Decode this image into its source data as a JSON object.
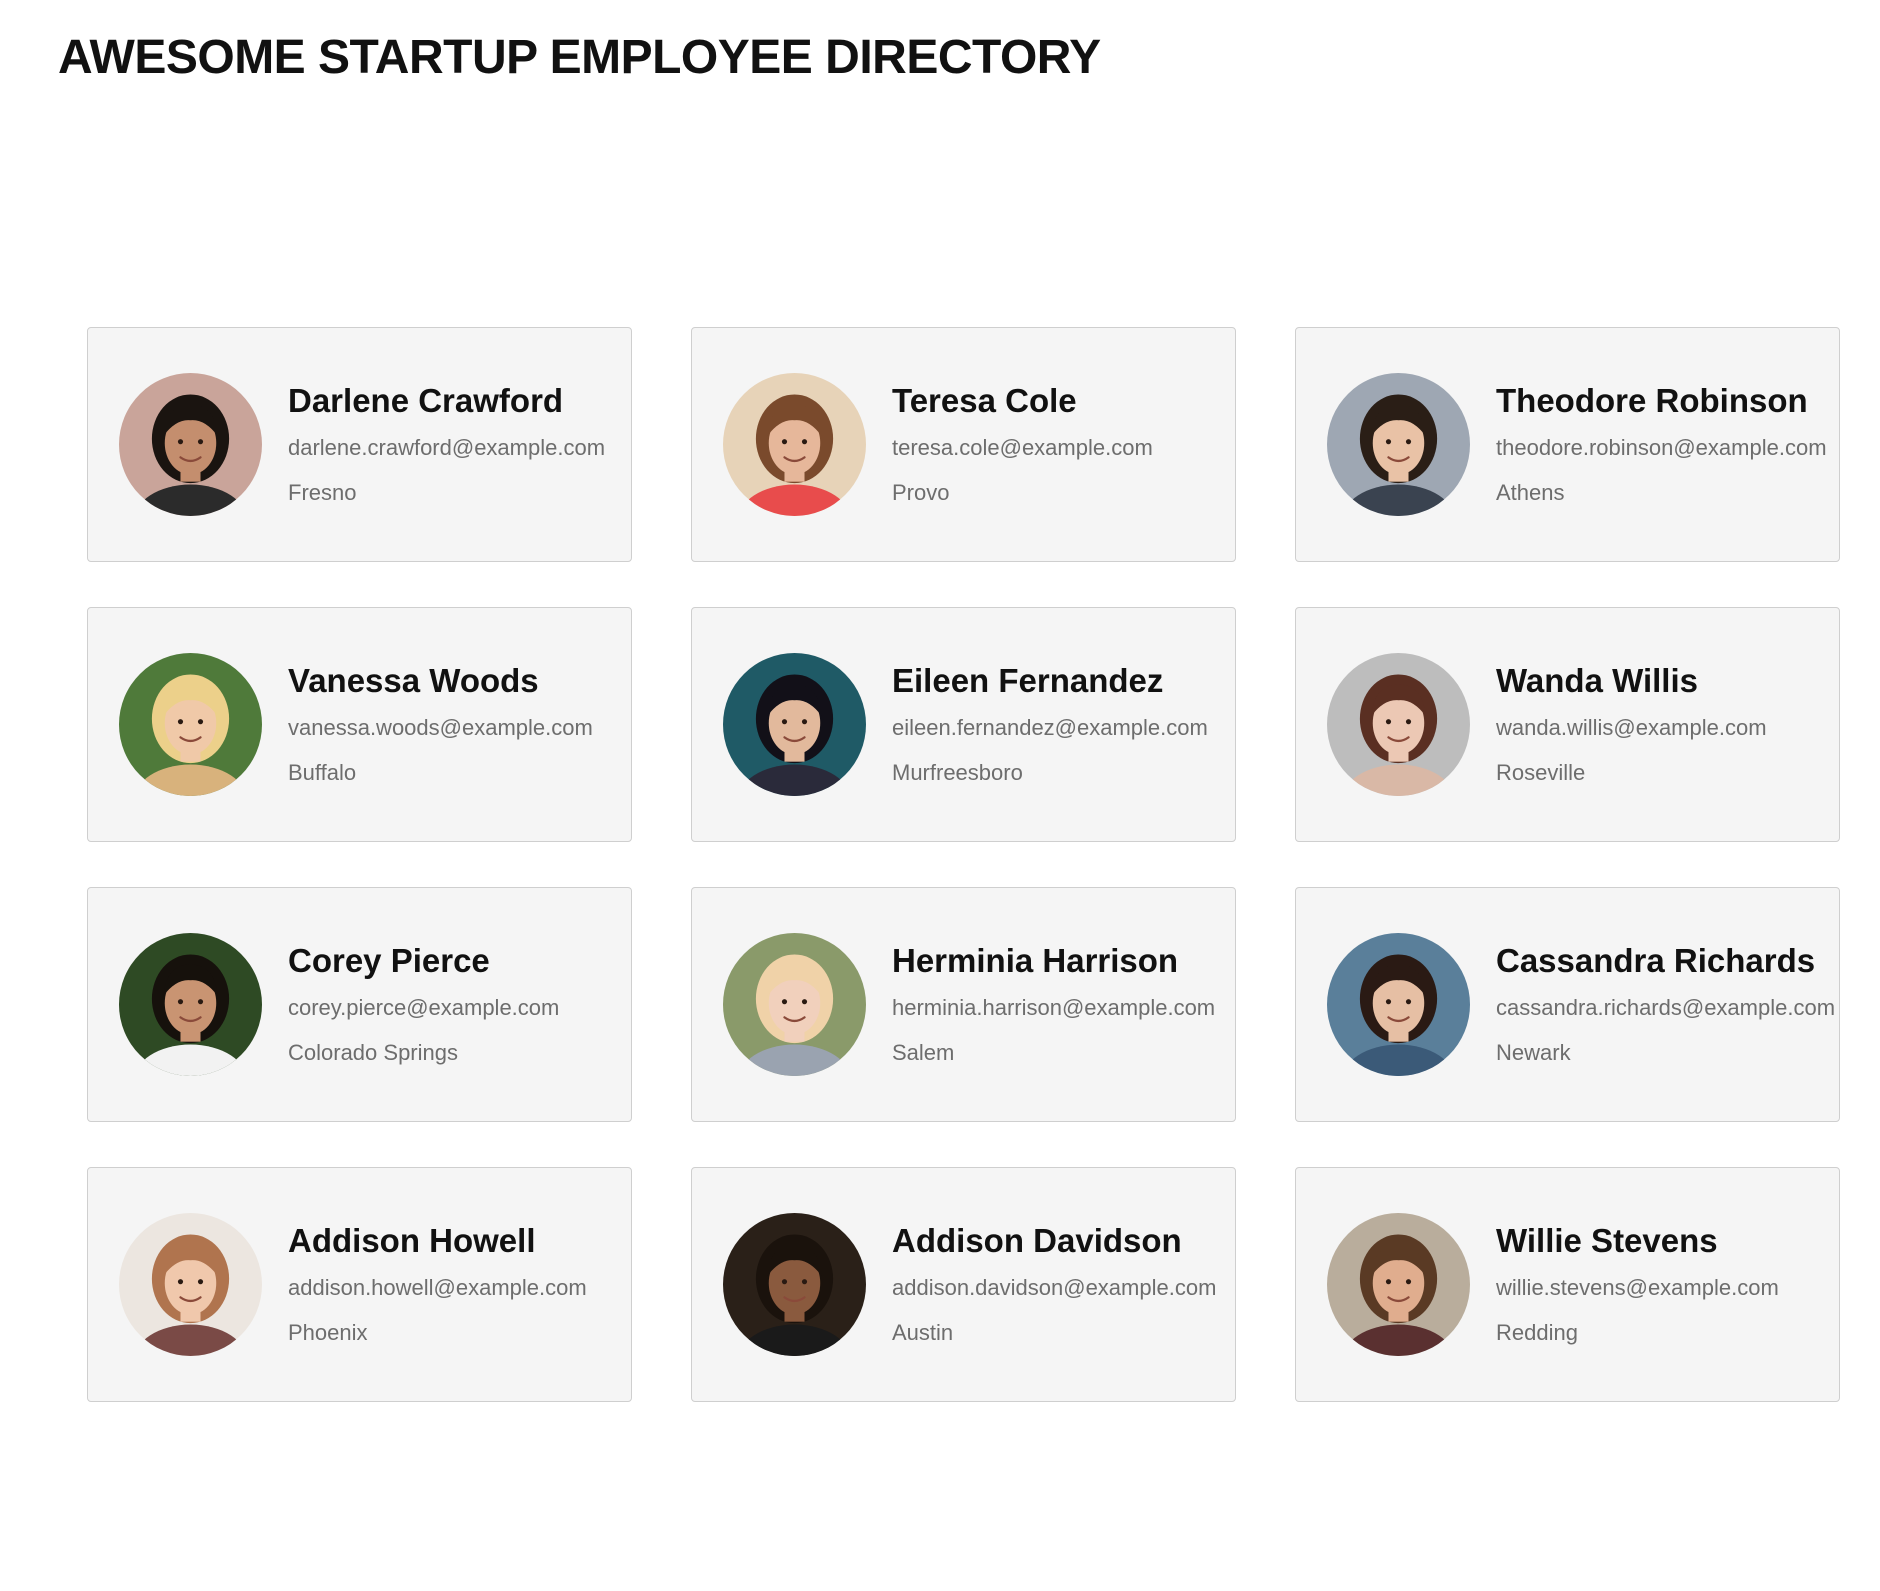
{
  "page": {
    "title": "AWESOME STARTUP EMPLOYEE DIRECTORY"
  },
  "employees": [
    {
      "name": "Darlene Crawford",
      "email": "darlene.crawford@example.com",
      "city": "Fresno",
      "avatar": {
        "bg": "#c9a49a",
        "hair": "#1a1410",
        "skin": "#c48e6e",
        "shirt": "#2b2b2b"
      }
    },
    {
      "name": "Teresa Cole",
      "email": "teresa.cole@example.com",
      "city": "Provo",
      "avatar": {
        "bg": "#e7d3b8",
        "hair": "#7a4a2c",
        "skin": "#e6b79a",
        "shirt": "#e84c4c"
      }
    },
    {
      "name": "Theodore Robinson",
      "email": "theodore.robinson@example.com",
      "city": "Athens",
      "avatar": {
        "bg": "#9ea7b3",
        "hair": "#2a1e16",
        "skin": "#e9c2a6",
        "shirt": "#3a4350"
      }
    },
    {
      "name": "Vanessa Woods",
      "email": "vanessa.woods@example.com",
      "city": "Buffalo",
      "avatar": {
        "bg": "#4f7a3a",
        "hair": "#ecd08a",
        "skin": "#f0c9a8",
        "shirt": "#d8b27c"
      }
    },
    {
      "name": "Eileen Fernandez",
      "email": "eileen.fernandez@example.com",
      "city": "Murfreesboro",
      "avatar": {
        "bg": "#1f5a66",
        "hair": "#121018",
        "skin": "#e2b99c",
        "shirt": "#2a2a3a"
      }
    },
    {
      "name": "Wanda Willis",
      "email": "wanda.willis@example.com",
      "city": "Roseville",
      "avatar": {
        "bg": "#bdbdbd",
        "hair": "#5a2f22",
        "skin": "#ecc8b4",
        "shirt": "#d9b8a6"
      }
    },
    {
      "name": "Corey Pierce",
      "email": "corey.pierce@example.com",
      "city": "Colorado Springs",
      "avatar": {
        "bg": "#2e4a24",
        "hair": "#16110c",
        "skin": "#c99472",
        "shirt": "#f2f2f2"
      }
    },
    {
      "name": "Herminia Harrison",
      "email": "herminia.harrison@example.com",
      "city": "Salem",
      "avatar": {
        "bg": "#8a9a6a",
        "hair": "#f0d2a8",
        "skin": "#f1d0bc",
        "shirt": "#9aa3b0"
      }
    },
    {
      "name": "Cassandra Richards",
      "email": "cassandra.richards@example.com",
      "city": "Newark",
      "avatar": {
        "bg": "#5a7f9a",
        "hair": "#2a1a14",
        "skin": "#e6bfa4",
        "shirt": "#3b5a78"
      }
    },
    {
      "name": "Addison Howell",
      "email": "addison.howell@example.com",
      "city": "Phoenix",
      "avatar": {
        "bg": "#ece6e0",
        "hair": "#b0744e",
        "skin": "#f0c8ac",
        "shirt": "#7a4a46"
      }
    },
    {
      "name": "Addison Davidson",
      "email": "addison.davidson@example.com",
      "city": "Austin",
      "avatar": {
        "bg": "#2a2018",
        "hair": "#1a120c",
        "skin": "#8a5a3e",
        "shirt": "#1a1a1a"
      }
    },
    {
      "name": "Willie Stevens",
      "email": "willie.stevens@example.com",
      "city": "Redding",
      "avatar": {
        "bg": "#b9ad9c",
        "hair": "#5a3a24",
        "skin": "#e0ad8e",
        "shirt": "#5a3030"
      }
    }
  ]
}
